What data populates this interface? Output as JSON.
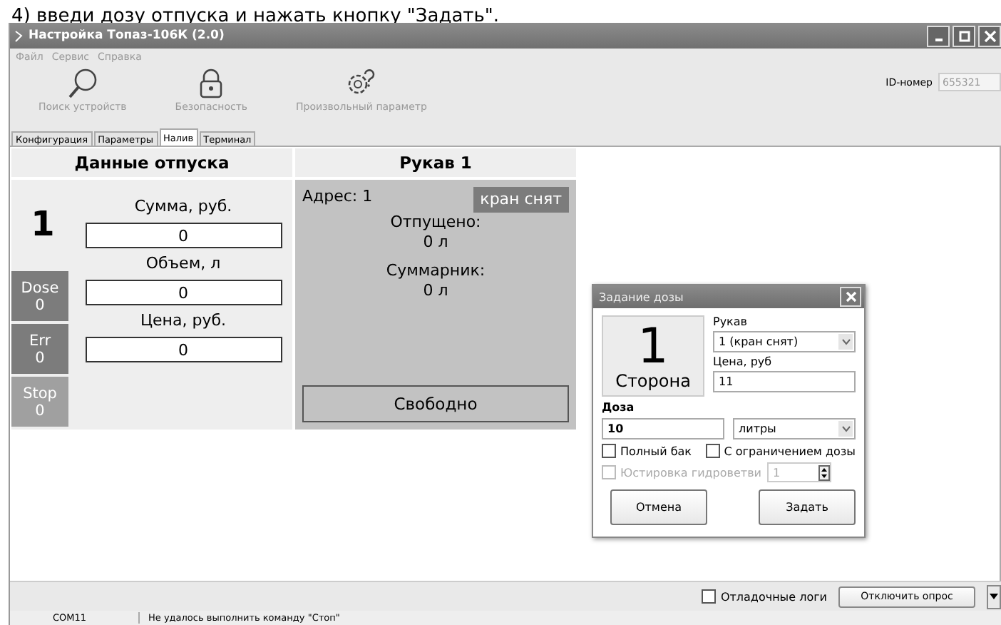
{
  "caption": "4) введи дозу отпуска и нажать кнопку \"Задать\".",
  "window": {
    "title": "Настройка Топаз-106К (2.0)"
  },
  "menu": [
    "Файл",
    "Сервис",
    "Справка"
  ],
  "toolbar": [
    {
      "label": "Поиск устройств",
      "kind": "search",
      "disabled": true
    },
    {
      "label": "Безопасность",
      "kind": "lock",
      "disabled": true
    },
    {
      "label": "Произвольный параметр",
      "kind": "gear",
      "disabled": true
    }
  ],
  "id_field": {
    "label": "ID-номер",
    "value": "655321",
    "disabled": true
  },
  "tabs": [
    {
      "label": "Конфигурация",
      "selected": false
    },
    {
      "label": "Параметры",
      "selected": false
    },
    {
      "label": "Налив",
      "selected": true
    },
    {
      "label": "Терминал",
      "selected": false
    }
  ],
  "dispense": {
    "title": "Данные отпуска",
    "side": "1",
    "counters": [
      {
        "label": "Dose",
        "value": "0",
        "color": "#7c7c7c"
      },
      {
        "label": "Err",
        "value": "0",
        "color": "#7c7c7c"
      },
      {
        "label": "Stop",
        "value": "0",
        "color": "#a0a0a0"
      }
    ],
    "fields": [
      {
        "label": "Сумма, руб.",
        "value": "0"
      },
      {
        "label": "Объем, л",
        "value": "0"
      },
      {
        "label": "Цена, руб.",
        "value": "0"
      }
    ]
  },
  "hose": {
    "title": "Рукав 1",
    "address": "Адрес: 1",
    "badge": "кран снят",
    "dispensed_label": "Отпущено:",
    "dispensed": "0 л",
    "total_label": "Суммарник:",
    "total": "0 л",
    "status": "Свободно"
  },
  "dialog": {
    "title": "Задание дозы",
    "side_number": "1",
    "side_label": "Сторона",
    "hose_label": "Рукав",
    "hose_value": "1 (кран снят)",
    "price_label": "Цена, руб",
    "price_value": "11",
    "dose_label": "Доза",
    "dose_value": "10",
    "unit": "литры",
    "checkboxes": [
      {
        "label": "Полный бак",
        "checked": false
      },
      {
        "label": "С ограничением дозы",
        "checked": false
      }
    ],
    "calibration": {
      "label": "Юстировка гидроветви",
      "checked": false,
      "disabled": true,
      "value": "1"
    },
    "buttons": [
      "Отмена",
      "Задать"
    ]
  },
  "bottom": {
    "debug_logs": {
      "label": "Отладочные логи",
      "checked": false
    },
    "button": "Отключить опрос"
  },
  "status_bar": [
    "COM11",
    "Не удалось выполнить команду \"Стоп\""
  ]
}
